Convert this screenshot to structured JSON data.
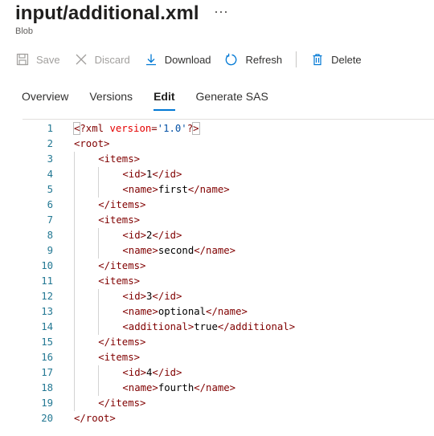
{
  "header": {
    "title": "input/additional.xml",
    "more": "⋯",
    "subtitle": "Blob"
  },
  "toolbar": {
    "save": "Save",
    "discard": "Discard",
    "download": "Download",
    "refresh": "Refresh",
    "delete": "Delete"
  },
  "tabs": [
    "Overview",
    "Versions",
    "Edit",
    "Generate SAS"
  ],
  "active_tab": "Edit",
  "editor": {
    "lines": [
      {
        "n": "1",
        "indent": 0,
        "segs": [
          [
            "b",
            "<"
          ],
          [
            "t",
            "?xml "
          ],
          [
            "a",
            "version"
          ],
          [
            "t",
            "="
          ],
          [
            "v",
            "'1.0'"
          ],
          [
            "t",
            "?"
          ],
          [
            "b",
            ">"
          ]
        ]
      },
      {
        "n": "2",
        "indent": 0,
        "segs": [
          [
            "t",
            "<root>"
          ]
        ]
      },
      {
        "n": "3",
        "indent": 1,
        "segs": [
          [
            "t",
            "<items>"
          ]
        ]
      },
      {
        "n": "4",
        "indent": 2,
        "segs": [
          [
            "t",
            "<id>"
          ],
          [
            "x",
            "1"
          ],
          [
            "t",
            "</id>"
          ]
        ]
      },
      {
        "n": "5",
        "indent": 2,
        "segs": [
          [
            "t",
            "<name>"
          ],
          [
            "x",
            "first"
          ],
          [
            "t",
            "</name>"
          ]
        ]
      },
      {
        "n": "6",
        "indent": 1,
        "segs": [
          [
            "t",
            "</items>"
          ]
        ]
      },
      {
        "n": "7",
        "indent": 1,
        "segs": [
          [
            "t",
            "<items>"
          ]
        ]
      },
      {
        "n": "8",
        "indent": 2,
        "segs": [
          [
            "t",
            "<id>"
          ],
          [
            "x",
            "2"
          ],
          [
            "t",
            "</id>"
          ]
        ]
      },
      {
        "n": "9",
        "indent": 2,
        "segs": [
          [
            "t",
            "<name>"
          ],
          [
            "x",
            "second"
          ],
          [
            "t",
            "</name>"
          ]
        ]
      },
      {
        "n": "10",
        "indent": 1,
        "segs": [
          [
            "t",
            "</items>"
          ]
        ]
      },
      {
        "n": "11",
        "indent": 1,
        "segs": [
          [
            "t",
            "<items>"
          ]
        ]
      },
      {
        "n": "12",
        "indent": 2,
        "segs": [
          [
            "t",
            "<id>"
          ],
          [
            "x",
            "3"
          ],
          [
            "t",
            "</id>"
          ]
        ]
      },
      {
        "n": "13",
        "indent": 2,
        "segs": [
          [
            "t",
            "<name>"
          ],
          [
            "x",
            "optional"
          ],
          [
            "t",
            "</name>"
          ]
        ]
      },
      {
        "n": "14",
        "indent": 2,
        "segs": [
          [
            "t",
            "<additional>"
          ],
          [
            "x",
            "true"
          ],
          [
            "t",
            "</additional>"
          ]
        ]
      },
      {
        "n": "15",
        "indent": 1,
        "segs": [
          [
            "t",
            "</items>"
          ]
        ]
      },
      {
        "n": "16",
        "indent": 1,
        "segs": [
          [
            "t",
            "<items>"
          ]
        ]
      },
      {
        "n": "17",
        "indent": 2,
        "segs": [
          [
            "t",
            "<id>"
          ],
          [
            "x",
            "4"
          ],
          [
            "t",
            "</id>"
          ]
        ]
      },
      {
        "n": "18",
        "indent": 2,
        "segs": [
          [
            "t",
            "<name>"
          ],
          [
            "x",
            "fourth"
          ],
          [
            "t",
            "</name>"
          ]
        ]
      },
      {
        "n": "19",
        "indent": 1,
        "segs": [
          [
            "t",
            "</items>"
          ]
        ]
      },
      {
        "n": "20",
        "indent": 0,
        "segs": [
          [
            "t",
            "</root>"
          ]
        ]
      }
    ]
  },
  "colors": {
    "accent": "#0078d4",
    "tag": "#800000",
    "attribute": "#e50000",
    "value": "#0451a5",
    "line_number": "#237893"
  }
}
